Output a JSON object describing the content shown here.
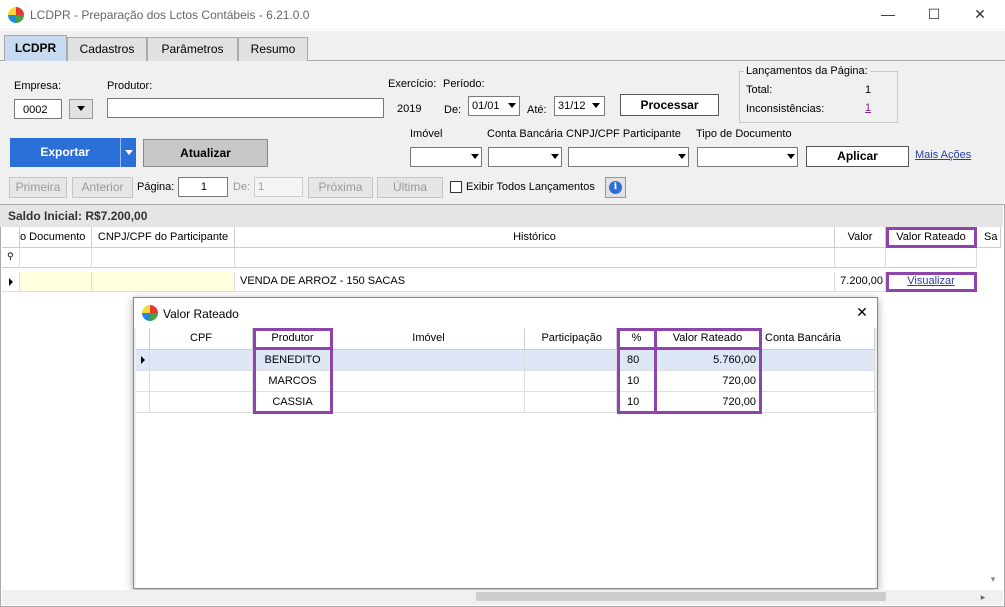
{
  "window": {
    "title": "LCDPR - Preparação dos Lctos Contábeis - 6.21.0.0",
    "minimize": "—",
    "maximize": "☐",
    "close": "✕"
  },
  "tabs": [
    {
      "label": "LCDPR",
      "active": true
    },
    {
      "label": "Cadastros",
      "active": false
    },
    {
      "label": "Parâmetros",
      "active": false
    },
    {
      "label": "Resumo",
      "active": false
    }
  ],
  "header": {
    "empresa_label": "Empresa:",
    "empresa_value": "0002",
    "produtor_label": "Produtor:",
    "produtor_value": "",
    "exercicio_label": "Exercício:",
    "exercicio_value": "2019",
    "periodo_label": "Período:",
    "de_label": "De:",
    "de_value": "01/01",
    "ate_label": "Até:",
    "ate_value": "31/12",
    "processar_label": "Processar",
    "lancamentos_title": "Lançamentos da Página:",
    "total_label": "Total:",
    "total_value": "1",
    "inconsistencias_label": "Inconsistências:",
    "inconsistencias_value": "1"
  },
  "actions": {
    "exportar_label": "Exportar",
    "atualizar_label": "Atualizar",
    "imovel_label": "Imóvel",
    "conta_label": "Conta Bancária",
    "cnpj_label": "CNPJ/CPF Participante",
    "tipo_label": "Tipo de Documento",
    "aplicar_label": "Aplicar",
    "mais_acoes_label": "Mais Ações"
  },
  "pager": {
    "primeira_label": "Primeira",
    "anterior_label": "Anterior",
    "pagina_label": "Página:",
    "pagina_value": "1",
    "de_label": "De:",
    "de_value": "1",
    "proxima_label": "Próxima",
    "ultima_label": "Última",
    "exibir_label": "Exibir Todos Lançamentos",
    "info_icon": "i"
  },
  "grid": {
    "saldo_inicial": "Saldo Inicial: R$7.200,00",
    "columns": [
      "o Documento",
      "CNPJ/CPF do Participante",
      "Histórico",
      "Valor",
      "Valor Rateado",
      "Sa"
    ],
    "row": {
      "documento": "",
      "cnpj": "",
      "historico": "VENDA DE ARROZ - 150 SACAS",
      "valor": "7.200,00",
      "valor_rateado_link": "Visualizar"
    }
  },
  "dialog": {
    "title": "Valor Rateado",
    "close": "✕",
    "columns": [
      "CPF",
      "Produtor",
      "Imóvel",
      "Participação",
      "%",
      "Valor Rateado",
      "Conta Bancária"
    ],
    "rows": [
      {
        "cpf": "",
        "produtor": "BENEDITO",
        "imovel": "",
        "participacao": "",
        "pct": "80",
        "valor": "5.760,00",
        "conta": ""
      },
      {
        "cpf": "",
        "produtor": "MARCOS",
        "imovel": "",
        "participacao": "",
        "pct": "10",
        "valor": "720,00",
        "conta": ""
      },
      {
        "cpf": "",
        "produtor": "CASSIA",
        "imovel": "",
        "participacao": "",
        "pct": "10",
        "valor": "720,00",
        "conta": ""
      }
    ]
  },
  "colors": {
    "accent_blue": "#2b6fd8",
    "highlight_purple": "#8e44ad",
    "tab_active": "#c7daf0"
  }
}
